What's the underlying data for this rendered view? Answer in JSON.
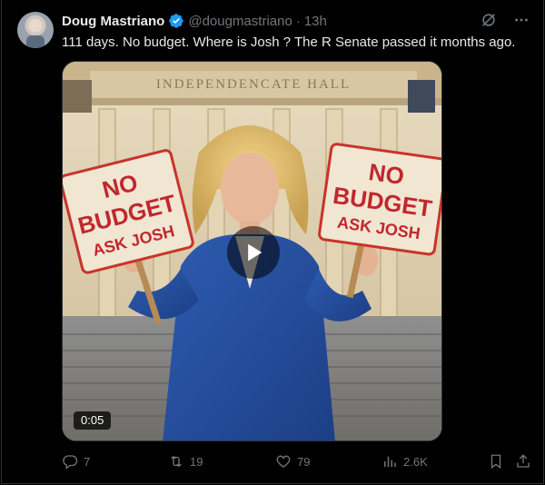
{
  "tweet": {
    "author_name": "Doug Mastriano",
    "handle": "@dougmastriano",
    "separator": "·",
    "time": "13h",
    "text": "111 days. No budget. Where is Josh ?  The R Senate passed it months ago.",
    "verified_color": "#1d9bf0"
  },
  "media": {
    "building_sign": "INDEPENDENCATE HALL",
    "left_sign": [
      "NO",
      "BUDGET",
      "ASK JOSH"
    ],
    "right_sign": [
      "NO",
      "BUDGET",
      "ASK JOSH"
    ],
    "duration": "0:05"
  },
  "actions": {
    "replies": "7",
    "reposts": "19",
    "likes": "79",
    "views": "2.6K"
  },
  "icons": [
    "grok-icon",
    "more-icon",
    "reply-icon",
    "repost-icon",
    "like-icon",
    "views-icon",
    "bookmark-icon",
    "share-icon",
    "play-icon",
    "verified-badge-icon"
  ]
}
